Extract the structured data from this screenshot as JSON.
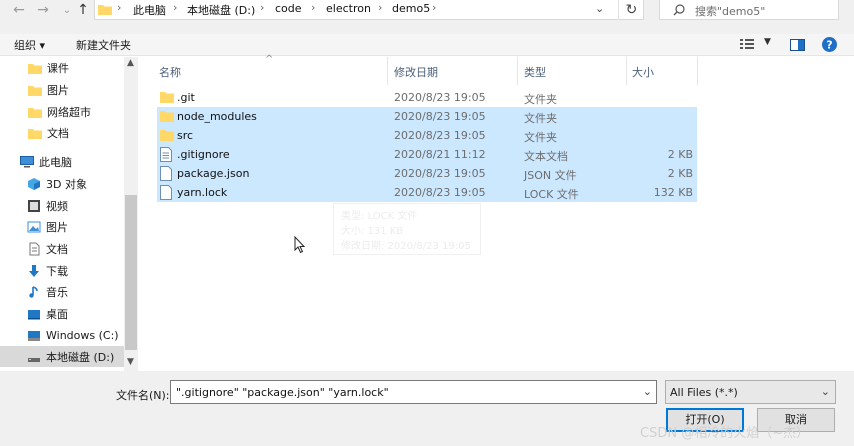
{
  "address": {
    "crumbs": [
      "此电脑",
      "本地磁盘 (D:)",
      "code",
      "electron",
      "demo5"
    ],
    "search_placeholder": "搜索\"demo5\""
  },
  "toolbar": {
    "organize": "组织 ▾",
    "new_folder": "新建文件夹"
  },
  "nav": {
    "items": [
      {
        "label": "课件",
        "icon": "folder-icon"
      },
      {
        "label": "图片",
        "icon": "folder-icon"
      },
      {
        "label": "网络超市",
        "icon": "folder-icon"
      },
      {
        "label": "文档",
        "icon": "folder-icon"
      },
      {
        "label": "此电脑",
        "icon": "computer-icon"
      },
      {
        "label": "3D 对象",
        "icon": "cube-icon"
      },
      {
        "label": "视频",
        "icon": "video-icon"
      },
      {
        "label": "图片",
        "icon": "picture-icon"
      },
      {
        "label": "文档",
        "icon": "document-icon"
      },
      {
        "label": "下载",
        "icon": "download-icon"
      },
      {
        "label": "音乐",
        "icon": "music-icon"
      },
      {
        "label": "桌面",
        "icon": "desktop-icon"
      },
      {
        "label": "Windows (C:)",
        "icon": "drive-icon"
      },
      {
        "label": "本地磁盘 (D:)",
        "icon": "drive-icon"
      }
    ]
  },
  "columns": {
    "name": "名称",
    "date": "修改日期",
    "type": "类型",
    "size": "大小"
  },
  "files": [
    {
      "name": ".git",
      "date": "2020/8/23 19:05",
      "type": "文件夹",
      "size": "",
      "icon": "folder-icon",
      "selected": false
    },
    {
      "name": "node_modules",
      "date": "2020/8/23 19:05",
      "type": "文件夹",
      "size": "",
      "icon": "folder-icon",
      "selected": true
    },
    {
      "name": "src",
      "date": "2020/8/23 19:05",
      "type": "文件夹",
      "size": "",
      "icon": "folder-icon",
      "selected": true
    },
    {
      "name": ".gitignore",
      "date": "2020/8/21 11:12",
      "type": "文本文档",
      "size": "2 KB",
      "icon": "text-file-icon",
      "selected": true
    },
    {
      "name": "package.json",
      "date": "2020/8/23 19:05",
      "type": "JSON 文件",
      "size": "2 KB",
      "icon": "file-icon",
      "selected": true
    },
    {
      "name": "yarn.lock",
      "date": "2020/8/23 19:05",
      "type": "LOCK 文件",
      "size": "132 KB",
      "icon": "file-icon",
      "selected": true
    }
  ],
  "tooltip": {
    "line1": "类型: LOCK 文件",
    "line2": "大小: 131 KB",
    "line3": "修改日期: 2020/8/23 19:05"
  },
  "footer": {
    "filename_label": "文件名(N):",
    "filename_value": "\".gitignore\" \"package.json\" \"yarn.lock\"",
    "filter_value": "All Files (*.*)",
    "open_label": "打开(O)",
    "cancel_label": "取消"
  },
  "watermark": "CSDN @相冷的火焰（~杰）",
  "colors": {
    "selection": "#cce8ff",
    "folder": "#ffd867",
    "accent": "#0078d7"
  }
}
